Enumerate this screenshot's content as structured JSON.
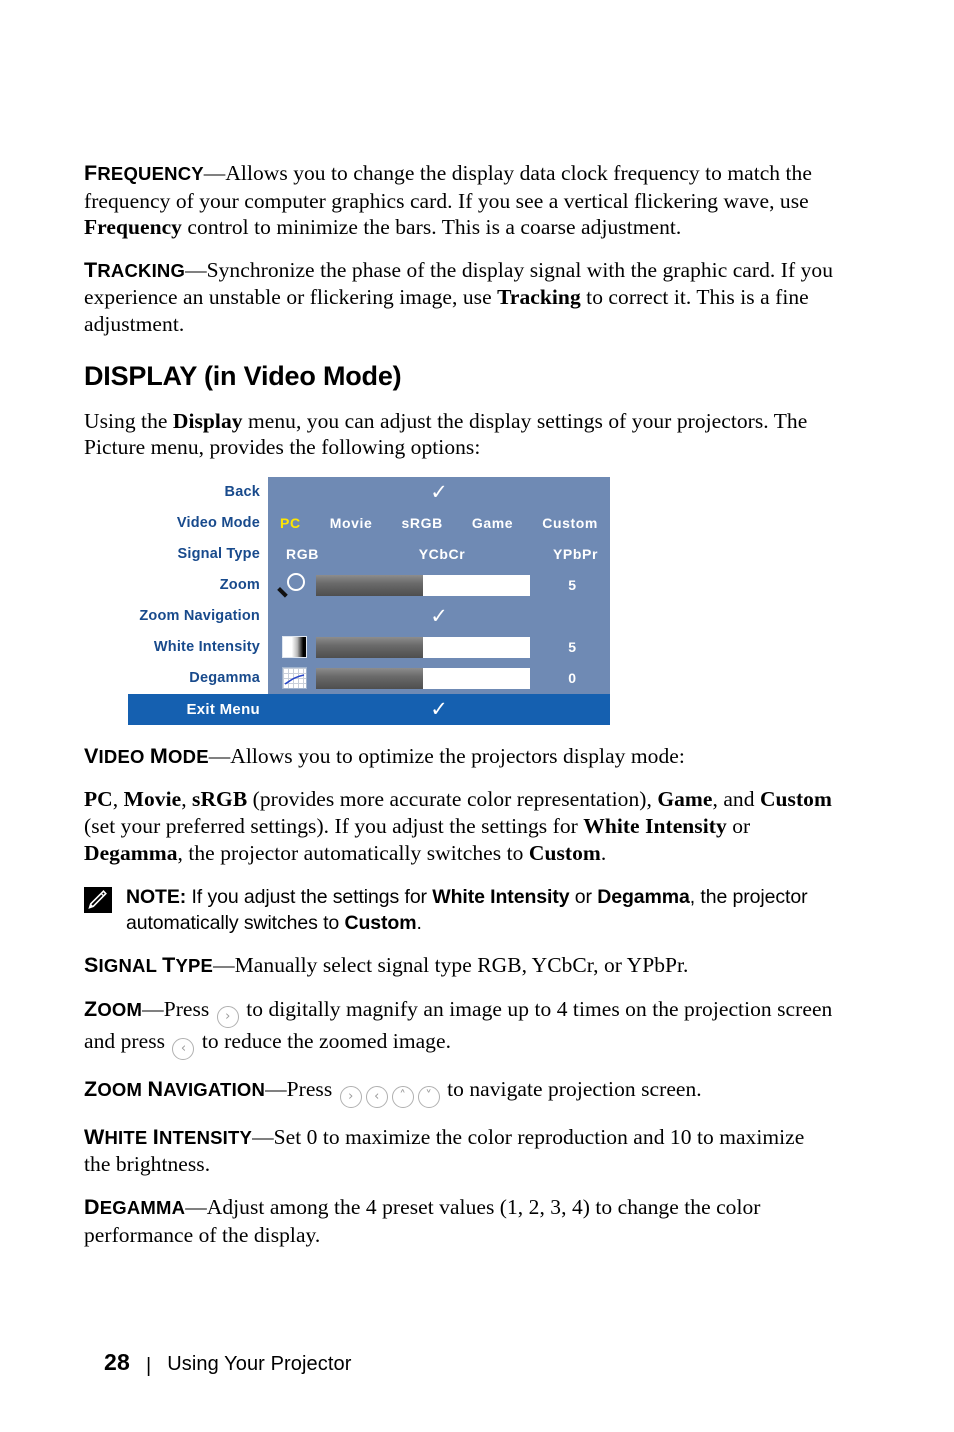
{
  "document": {
    "paragraphs": [
      {
        "id": "frequency",
        "term_cap": "F",
        "term_rest": "REQUENCY",
        "body_1": "—Allows you to change the display data clock frequency to match the frequency of your computer graphics card. If you see a vertical flickering wave, use ",
        "bold_1": "Frequency",
        "body_2": " control to minimize the bars. This is a coarse adjustment."
      },
      {
        "id": "tracking",
        "term_cap": "T",
        "term_rest": "RACKING",
        "body_1": "—Synchronize the phase of the display signal with the graphic card. If you experience an unstable or flickering image, use ",
        "bold_1": "Tracking",
        "body_2": " to correct it. This is a fine adjustment."
      }
    ],
    "heading": "DISPLAY (in Video Mode)",
    "intro": {
      "part_1": "Using the ",
      "bold_1": "Display",
      "part_2": " menu, you can adjust the display settings of your projectors. The Picture menu, provides the following options:"
    },
    "video_mode": {
      "term_cap": "V",
      "term_rest": "IDEO ",
      "term_cap2": "M",
      "term_rest2": "ODE",
      "body": "—Allows you to optimize the projectors display mode:"
    },
    "modes_paragraph": {
      "b1": "PC",
      "t1": ", ",
      "b2": "Movie",
      "t2": ", ",
      "b3": "sRGB",
      "t3": " (provides more accurate color representation), ",
      "b4": "Game",
      "t4": ", and ",
      "b5": "Custom",
      "t5": " (set your preferred settings). If you adjust the settings for ",
      "b6": "White Intensity",
      "t6": " or ",
      "b7": "Degamma",
      "t7": ", the projector automatically switches to ",
      "b8": "Custom",
      "t8": "."
    },
    "note": {
      "icon": "note-pencil-icon",
      "label": "NOTE:",
      "t1": " If you adjust the settings for ",
      "b1": "White Intensity",
      "t2": " or ",
      "b2": "Degamma",
      "t3": ", the projector automatically switches to ",
      "b3": "Custom",
      "t4": "."
    },
    "signal_type": {
      "term_cap": "S",
      "term_rest": "IGNAL ",
      "term_cap2": "T",
      "term_rest2": "YPE",
      "body": "—Manually select signal type RGB, YCbCr, or YPbPr."
    },
    "zoom": {
      "term_cap": "Z",
      "term_rest": "OOM",
      "t1": "—Press ",
      "btn_1": "›",
      "t2": " to digitally magnify an image up to 4 times on the projection screen and press ",
      "btn_2": "‹",
      "t3": " to reduce the zoomed image."
    },
    "zoom_navigation": {
      "term_cap": "Z",
      "term_rest": "OOM ",
      "term_cap2": "N",
      "term_rest2": "AVIGATION",
      "t1": "—Press ",
      "btn_1": "›",
      "btn_2": "‹",
      "btn_3": "˄",
      "btn_4": "˅",
      "t2": " to navigate projection screen."
    },
    "white_intensity": {
      "term_cap": "W",
      "term_rest": "HITE ",
      "term_cap2": "I",
      "term_rest2": "NTENSITY",
      "body": "—Set 0 to maximize the color reproduction and 10 to maximize the brightness."
    },
    "degamma": {
      "term_cap": "D",
      "term_rest": "EGAMMA",
      "body": "—Adjust among the 4 preset values (1, 2, 3, 4) to change the color performance of the display."
    }
  },
  "osd_menu": {
    "colors": {
      "panel_bg": "#6f8ab4",
      "label_text": "#184a8c",
      "selected_option": "#ffe600",
      "exit_bar": "#1560b0",
      "slider_track": "#ffffff",
      "slider_fill": "#5e5e5e"
    },
    "rows": [
      {
        "label": "Back",
        "type": "check",
        "check": "✓"
      },
      {
        "label": "Video Mode",
        "type": "options",
        "options": [
          "PC",
          "Movie",
          "sRGB",
          "Game",
          "Custom"
        ],
        "selected": "PC"
      },
      {
        "label": "Signal Type",
        "type": "options3",
        "options": [
          "RGB",
          "YCbCr",
          "YPbPr"
        ],
        "selected": "RGB"
      },
      {
        "label": "Zoom",
        "type": "slider",
        "icon": "magnifier-icon",
        "value": "5",
        "fill_percent": 50
      },
      {
        "label": "Zoom Navigation",
        "type": "check",
        "check": "✓"
      },
      {
        "label": "White Intensity",
        "type": "slider",
        "icon": "white-intensity-icon",
        "value": "5",
        "fill_percent": 50
      },
      {
        "label": "Degamma",
        "type": "slider",
        "icon": "degamma-icon",
        "value": "0",
        "fill_percent": 50
      }
    ],
    "exit": {
      "label": "Exit Menu",
      "check": "✓"
    }
  },
  "footer": {
    "page_number": "28",
    "separator": "|",
    "title": "Using Your Projector"
  }
}
